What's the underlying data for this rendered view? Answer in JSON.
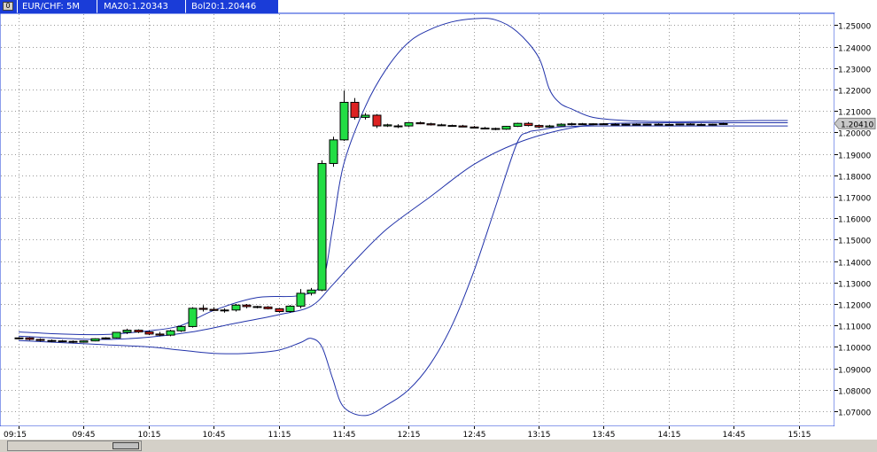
{
  "header": {
    "icon_label": "0",
    "symbol": "EUR/CHF: 5M",
    "ma": "MA20:1.20343",
    "bol": "Bol20:1.20446"
  },
  "colors": {
    "background": "#ffffff",
    "frame": "#1a3cd8",
    "bands": "#2233aa",
    "bull": "#22dd44",
    "bear": "#dd2222",
    "grid": "#999999",
    "price_tag": "#c8c8c8"
  },
  "chart_data": {
    "type": "candlestick",
    "instrument": "EUR/CHF",
    "timeframe": "5M",
    "ylim": [
      1.063,
      1.2555
    ],
    "y_ticks": [
      "1.25000",
      "1.24000",
      "1.23000",
      "1.22000",
      "1.21000",
      "1.20000",
      "1.19000",
      "1.18000",
      "1.17000",
      "1.16000",
      "1.15000",
      "1.14000",
      "1.13000",
      "1.12000",
      "1.11000",
      "1.10000",
      "1.09000",
      "1.08000",
      "1.07000"
    ],
    "x_ticks": [
      "09:15",
      "09:45",
      "10:15",
      "10:45",
      "11:15",
      "11:45",
      "12:15",
      "12:45",
      "13:15",
      "13:45",
      "14:15",
      "14:45",
      "15:15"
    ],
    "x_tick_index": [
      0,
      6,
      12,
      18,
      24,
      30,
      36,
      42,
      48,
      54,
      60,
      66,
      72
    ],
    "last_price": "1.20410",
    "candles": [
      [
        1.104,
        1.1045,
        1.1035,
        1.1042
      ],
      [
        1.1042,
        1.1045,
        1.103,
        1.1035
      ],
      [
        1.1035,
        1.104,
        1.1025,
        1.103
      ],
      [
        1.103,
        1.1035,
        1.1022,
        1.1028
      ],
      [
        1.1028,
        1.1032,
        1.1022,
        1.1026
      ],
      [
        1.1026,
        1.103,
        1.1018,
        1.1022
      ],
      [
        1.1022,
        1.103,
        1.102,
        1.1028
      ],
      [
        1.1028,
        1.104,
        1.1026,
        1.1038
      ],
      [
        1.1038,
        1.1045,
        1.1035,
        1.1042
      ],
      [
        1.1042,
        1.107,
        1.104,
        1.1068
      ],
      [
        1.1068,
        1.1085,
        1.106,
        1.1078
      ],
      [
        1.1078,
        1.1082,
        1.1065,
        1.107
      ],
      [
        1.107,
        1.1075,
        1.1055,
        1.106
      ],
      [
        1.106,
        1.107,
        1.105,
        1.1055
      ],
      [
        1.1055,
        1.108,
        1.105,
        1.1075
      ],
      [
        1.1075,
        1.11,
        1.107,
        1.1095
      ],
      [
        1.1095,
        1.1185,
        1.109,
        1.118
      ],
      [
        1.118,
        1.1195,
        1.1165,
        1.1175
      ],
      [
        1.1175,
        1.1185,
        1.1168,
        1.117
      ],
      [
        1.117,
        1.118,
        1.116,
        1.1172
      ],
      [
        1.1172,
        1.12,
        1.1165,
        1.1195
      ],
      [
        1.1195,
        1.12,
        1.118,
        1.1188
      ],
      [
        1.1188,
        1.1192,
        1.118,
        1.1186
      ],
      [
        1.1186,
        1.119,
        1.1175,
        1.1178
      ],
      [
        1.1178,
        1.1182,
        1.116,
        1.1165
      ],
      [
        1.1165,
        1.1195,
        1.116,
        1.119
      ],
      [
        1.119,
        1.127,
        1.118,
        1.125
      ],
      [
        1.125,
        1.1275,
        1.124,
        1.1265
      ],
      [
        1.1265,
        1.187,
        1.126,
        1.1855
      ],
      [
        1.1855,
        1.198,
        1.184,
        1.1965
      ],
      [
        1.1965,
        1.2195,
        1.196,
        1.214
      ],
      [
        1.214,
        1.216,
        1.206,
        1.207
      ],
      [
        1.207,
        1.209,
        1.206,
        1.208
      ],
      [
        1.208,
        1.2085,
        1.202,
        1.203
      ],
      [
        1.203,
        1.204,
        1.2025,
        1.2035
      ],
      [
        1.2028,
        1.2038,
        1.202,
        1.203
      ],
      [
        1.203,
        1.2048,
        1.2025,
        1.2045
      ],
      [
        1.2045,
        1.205,
        1.2038,
        1.204
      ],
      [
        1.204,
        1.2045,
        1.2032,
        1.2035
      ],
      [
        1.2035,
        1.204,
        1.203,
        1.2032
      ],
      [
        1.2032,
        1.2036,
        1.2028,
        1.203
      ],
      [
        1.203,
        1.2035,
        1.2024,
        1.2025
      ],
      [
        1.2025,
        1.203,
        1.2018,
        1.202
      ],
      [
        1.202,
        1.2025,
        1.2015,
        1.2018
      ],
      [
        1.2018,
        1.2022,
        1.201,
        1.2015
      ],
      [
        1.2015,
        1.203,
        1.2012,
        1.2028
      ],
      [
        1.2028,
        1.2045,
        1.2025,
        1.2042
      ],
      [
        1.2042,
        1.2048,
        1.2028,
        1.2032
      ],
      [
        1.2032,
        1.2036,
        1.202,
        1.2025
      ],
      [
        1.2025,
        1.2035,
        1.2022,
        1.203
      ],
      [
        1.203,
        1.2042,
        1.2028,
        1.2038
      ],
      [
        1.2038,
        1.2045,
        1.2032,
        1.204
      ],
      [
        1.204,
        1.2044,
        1.2035,
        1.2038
      ],
      [
        1.2038,
        1.2042,
        1.2034,
        1.204
      ],
      [
        1.204,
        1.2044,
        1.2036,
        1.2038
      ],
      [
        1.2038,
        1.2042,
        1.2034,
        1.2036
      ],
      [
        1.2036,
        1.204,
        1.2032,
        1.2038
      ],
      [
        1.2038,
        1.2041,
        1.2034,
        1.2036
      ],
      [
        1.2036,
        1.204,
        1.2033,
        1.2038
      ],
      [
        1.2038,
        1.2042,
        1.2035,
        1.2037
      ],
      [
        1.2037,
        1.2041,
        1.2034,
        1.2036
      ],
      [
        1.2036,
        1.204,
        1.2033,
        1.2039
      ],
      [
        1.2039,
        1.2042,
        1.2035,
        1.2037
      ],
      [
        1.2037,
        1.2041,
        1.2034,
        1.2036
      ],
      [
        1.2036,
        1.204,
        1.2032,
        1.2038
      ],
      [
        1.2038,
        1.2045,
        1.2035,
        1.2041
      ]
    ],
    "bollinger": {
      "upper": [
        [
          0,
          1.107
        ],
        [
          4,
          1.106
        ],
        [
          8,
          1.1058
        ],
        [
          12,
          1.1075
        ],
        [
          15,
          1.11
        ],
        [
          18,
          1.117
        ],
        [
          22,
          1.123
        ],
        [
          26,
          1.124
        ],
        [
          28,
          1.13
        ],
        [
          29,
          1.156
        ],
        [
          30,
          1.185
        ],
        [
          32,
          1.212
        ],
        [
          34,
          1.23
        ],
        [
          36,
          1.242
        ],
        [
          38,
          1.248
        ],
        [
          40,
          1.2515
        ],
        [
          42,
          1.253
        ],
        [
          44,
          1.2525
        ],
        [
          46,
          1.247
        ],
        [
          48,
          1.235
        ],
        [
          49,
          1.22
        ],
        [
          50,
          1.2135
        ],
        [
          51,
          1.211
        ],
        [
          53,
          1.207
        ],
        [
          56,
          1.2055
        ],
        [
          60,
          1.205
        ],
        [
          64,
          1.2052
        ],
        [
          68,
          1.2055
        ],
        [
          71,
          1.2055
        ]
      ],
      "middle": [
        [
          0,
          1.105
        ],
        [
          4,
          1.104
        ],
        [
          8,
          1.1035
        ],
        [
          12,
          1.1045
        ],
        [
          16,
          1.107
        ],
        [
          20,
          1.111
        ],
        [
          24,
          1.115
        ],
        [
          27,
          1.119
        ],
        [
          29,
          1.129
        ],
        [
          31,
          1.14
        ],
        [
          34,
          1.155
        ],
        [
          38,
          1.17
        ],
        [
          42,
          1.185
        ],
        [
          46,
          1.195
        ],
        [
          50,
          1.201
        ],
        [
          54,
          1.204
        ],
        [
          60,
          1.2045
        ],
        [
          66,
          1.2045
        ],
        [
          71,
          1.2045
        ]
      ],
      "lower": [
        [
          0,
          1.103
        ],
        [
          4,
          1.102
        ],
        [
          8,
          1.101
        ],
        [
          12,
          1.1
        ],
        [
          15,
          1.0985
        ],
        [
          18,
          1.097
        ],
        [
          21,
          1.097
        ],
        [
          24,
          1.0985
        ],
        [
          26,
          1.102
        ],
        [
          27,
          1.104
        ],
        [
          28,
          1.1
        ],
        [
          29,
          1.085
        ],
        [
          30,
          1.072
        ],
        [
          32,
          1.068
        ],
        [
          34,
          1.073
        ],
        [
          36,
          1.08
        ],
        [
          38,
          1.092
        ],
        [
          40,
          1.11
        ],
        [
          42,
          1.135
        ],
        [
          44,
          1.165
        ],
        [
          46,
          1.195
        ],
        [
          47,
          1.2
        ],
        [
          48,
          1.201
        ],
        [
          50,
          1.2025
        ],
        [
          53,
          1.203
        ],
        [
          60,
          1.203
        ],
        [
          66,
          1.203
        ],
        [
          71,
          1.203
        ]
      ]
    }
  }
}
